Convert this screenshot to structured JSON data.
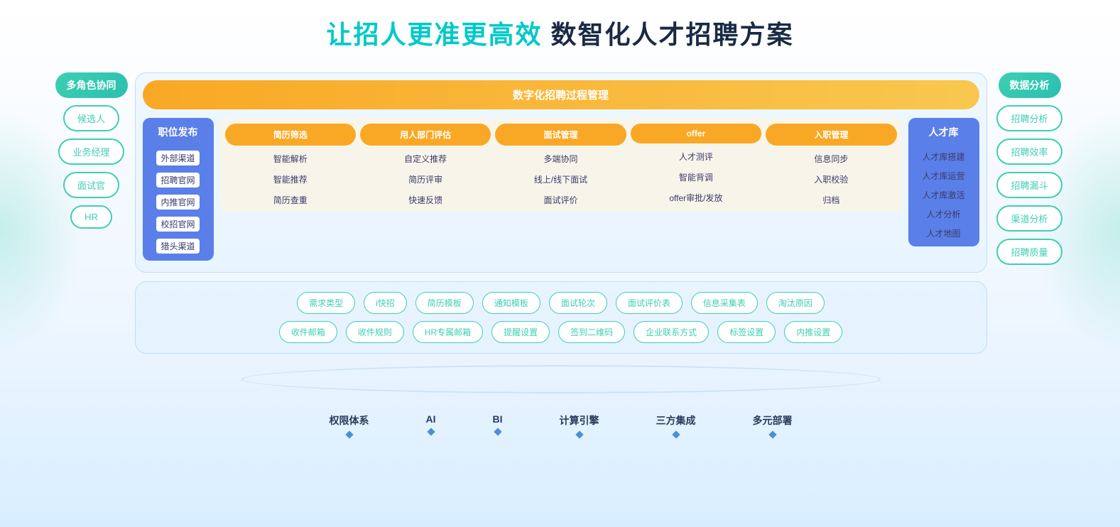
{
  "title": {
    "part1": "让招人更准更高效",
    "part2": " 数智化人才招聘方案"
  },
  "left_sidebar": {
    "title": "多角色协同",
    "pills": [
      "候选人",
      "业务经理",
      "面试官",
      "HR"
    ]
  },
  "right_sidebar": {
    "title": "数据分析",
    "pills": [
      "招聘分析",
      "招聘效率",
      "招聘漏斗",
      "渠道分析",
      "招聘质量"
    ]
  },
  "process_header": "数字化招聘过程管理",
  "job_posting": {
    "title": "职位发布",
    "items": [
      "外部渠道",
      "招聘官网",
      "内推官网",
      "校招官网",
      "猎头渠道"
    ]
  },
  "steps": [
    {
      "title": "简历筛选",
      "style": "orange",
      "items": [
        "智能解析",
        "智能推荐",
        "简历查重"
      ]
    },
    {
      "title": "用人部门评估",
      "style": "orange",
      "items": [
        "自定义推荐",
        "简历评审",
        "快速反馈"
      ]
    },
    {
      "title": "面试管理",
      "style": "orange",
      "items": [
        "多端协同",
        "线上/线下面试",
        "面试评价"
      ]
    },
    {
      "title": "offer",
      "style": "orange",
      "items": [
        "人才测评",
        "智能背调",
        "offer审批/发放"
      ]
    },
    {
      "title": "入职管理",
      "style": "orange",
      "items": [
        "信息同步",
        "入职校验",
        "归档"
      ]
    }
  ],
  "talent_pool": {
    "title": "人才库",
    "items": [
      "人才库搭建",
      "人才库运营",
      "人才库激活",
      "人才分析",
      "人才地图"
    ]
  },
  "tools_row1": [
    "需求类型",
    "i快招",
    "简历模板",
    "通知模板",
    "面试轮次",
    "面试评价表",
    "信息采集表",
    "淘汰原因"
  ],
  "tools_row2": [
    "收件邮箱",
    "收件规则",
    "HR专属邮箱",
    "提醒设置",
    "签到二维码",
    "企业联系方式",
    "标签设置",
    "内推设置"
  ],
  "bottom_labels": [
    "权限体系",
    "AI",
    "BI",
    "计算引擎",
    "三方集成",
    "多元部署"
  ]
}
